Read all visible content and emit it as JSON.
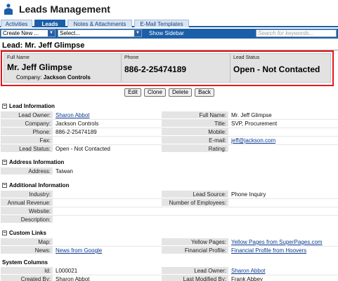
{
  "app": {
    "title": "Leads Management"
  },
  "tabs": [
    {
      "label": "Activities"
    },
    {
      "label": "Leads"
    },
    {
      "label": "Notes & Attachments"
    },
    {
      "label": "E-Mail Templates"
    }
  ],
  "toolbar": {
    "create_new": "Create New ...",
    "select": "Select...",
    "show_sidebar": "Show Sidebar",
    "search_placeholder": "Search for keywords..."
  },
  "page_title": "Lead: Mr. Jeff Glimpse",
  "highlight": {
    "full_name_label": "Full Name",
    "full_name": "Mr. Jeff Glimpse",
    "company_label": "Company:",
    "company": "Jackson Controls",
    "phone_label": "Phone",
    "phone": "886-2-25474189",
    "status_label": "Lead Status",
    "status": "Open - Not Contacted"
  },
  "buttons": {
    "edit": "Edit",
    "clone": "Clone",
    "delete": "Delete",
    "back": "Back"
  },
  "sections": {
    "lead_info": {
      "title": "Lead Information",
      "rows": [
        {
          "l1": "Lead Owner:",
          "v1": "Sharon Abbot",
          "l2": "Full Name:",
          "v2": "Mr. Jeff Glimpse"
        },
        {
          "l1": "Company:",
          "v1": "Jackson Controls",
          "l2": "Title:",
          "v2": "SVP, Procurement"
        },
        {
          "l1": "Phone:",
          "v1": "886-2-25474189",
          "l2": "Mobile:",
          "v2": ""
        },
        {
          "l1": "Fax:",
          "v1": "",
          "l2": "E-mail:",
          "v2": "jeff@jackson.com"
        },
        {
          "l1": "Lead Status:",
          "v1": "Open - Not Contacted",
          "l2": "Rating:",
          "v2": ""
        }
      ]
    },
    "address_info": {
      "title": "Address Information",
      "rows": [
        {
          "l1": "Address:",
          "v1": "Taiwan"
        }
      ]
    },
    "additional_info": {
      "title": "Additional Information",
      "rows": [
        {
          "l1": "Industry:",
          "v1": "",
          "l2": "Lead Source:",
          "v2": "Phone Inquiry"
        },
        {
          "l1": "Annual Revenue:",
          "v1": "",
          "l2": "Number of Employees:",
          "v2": ""
        },
        {
          "l1": "Website:",
          "v1": ""
        },
        {
          "l1": "Description:",
          "v1": ""
        }
      ]
    },
    "custom_links": {
      "title": "Custom Links",
      "rows": [
        {
          "l1": "Map:",
          "v1": "",
          "l2": "Yellow Pages:",
          "v2": "Yellow Pages from SuperPages.com"
        },
        {
          "l1": "News:",
          "v1": "News from Google",
          "l2": "Financial Profile:",
          "v2": "Financial Profile from Hoovers"
        }
      ]
    },
    "system_columns": {
      "title": "System Columns",
      "rows": [
        {
          "l1": "Id:",
          "v1": "L000021",
          "l2": "Lead Owner:",
          "v2": "Sharon Abbot"
        },
        {
          "l1": "Created By:",
          "v1": "Sharon Abbot",
          "l2": "Last Modified By:",
          "v2": "Frank Abbey"
        }
      ]
    }
  },
  "colors": {
    "accent": "#1b5fa8",
    "highlight_border": "#e1181f",
    "label_bg": "#e4e4e4",
    "link": "#0b3a8e"
  }
}
